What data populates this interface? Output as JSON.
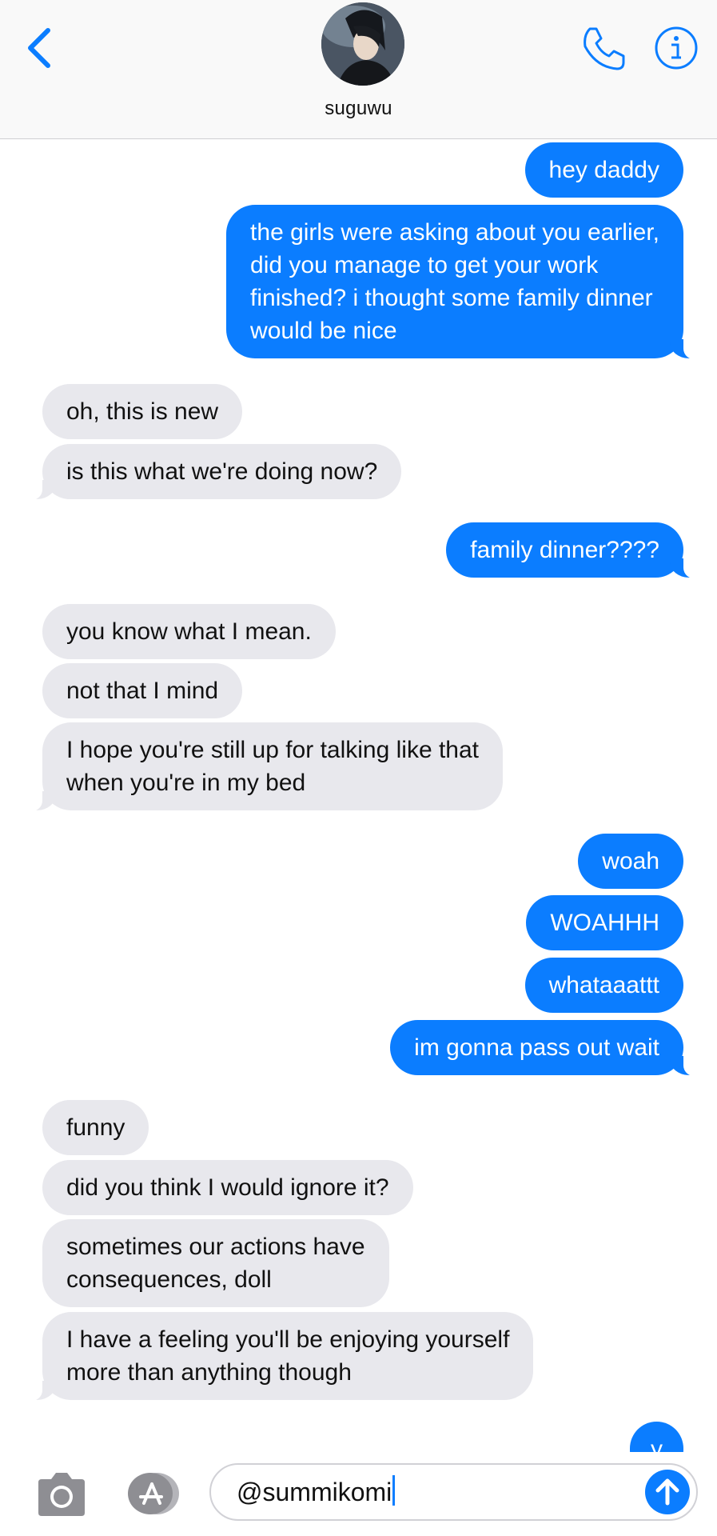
{
  "header": {
    "contact_name": "suguwu",
    "back_icon": "chevron-left-icon",
    "call_icon": "phone-icon",
    "info_icon": "info-icon",
    "accent_color": "#0b7dff"
  },
  "messages": [
    {
      "direction": "outgoing",
      "text": "hey daddy"
    },
    {
      "direction": "outgoing",
      "lines": [
        "the girls were asking about you earlier,",
        "did you manage to get your work",
        "finished? i thought some family dinner",
        "would be nice"
      ]
    },
    {
      "direction": "incoming",
      "text": "oh, this is new"
    },
    {
      "direction": "incoming",
      "text": "is this what we're doing now?"
    },
    {
      "direction": "outgoing",
      "text": "family dinner????"
    },
    {
      "direction": "incoming",
      "text": "you know what I mean."
    },
    {
      "direction": "incoming",
      "text": "not that I mind"
    },
    {
      "direction": "incoming",
      "lines": [
        "I hope you're still up for talking like that",
        "when you're in my bed"
      ]
    },
    {
      "direction": "outgoing",
      "text": "woah"
    },
    {
      "direction": "outgoing",
      "text": "WOAHHH"
    },
    {
      "direction": "outgoing",
      "text": "whataaattt"
    },
    {
      "direction": "outgoing",
      "text": "im gonna pass out wait"
    },
    {
      "direction": "incoming",
      "text": "funny"
    },
    {
      "direction": "incoming",
      "text": "did you think I would ignore it?"
    },
    {
      "direction": "incoming",
      "lines": [
        "sometimes our actions have",
        "consequences, doll"
      ]
    },
    {
      "direction": "incoming",
      "lines": [
        "I have a feeling you'll be enjoying yourself",
        "more than anything though"
      ]
    },
    {
      "direction": "outgoing",
      "text": "y"
    }
  ],
  "composer": {
    "camera_icon": "camera-icon",
    "apps_icon": "app-store-icon",
    "input_value": "@summikomi",
    "send_icon": "arrow-up-icon"
  }
}
